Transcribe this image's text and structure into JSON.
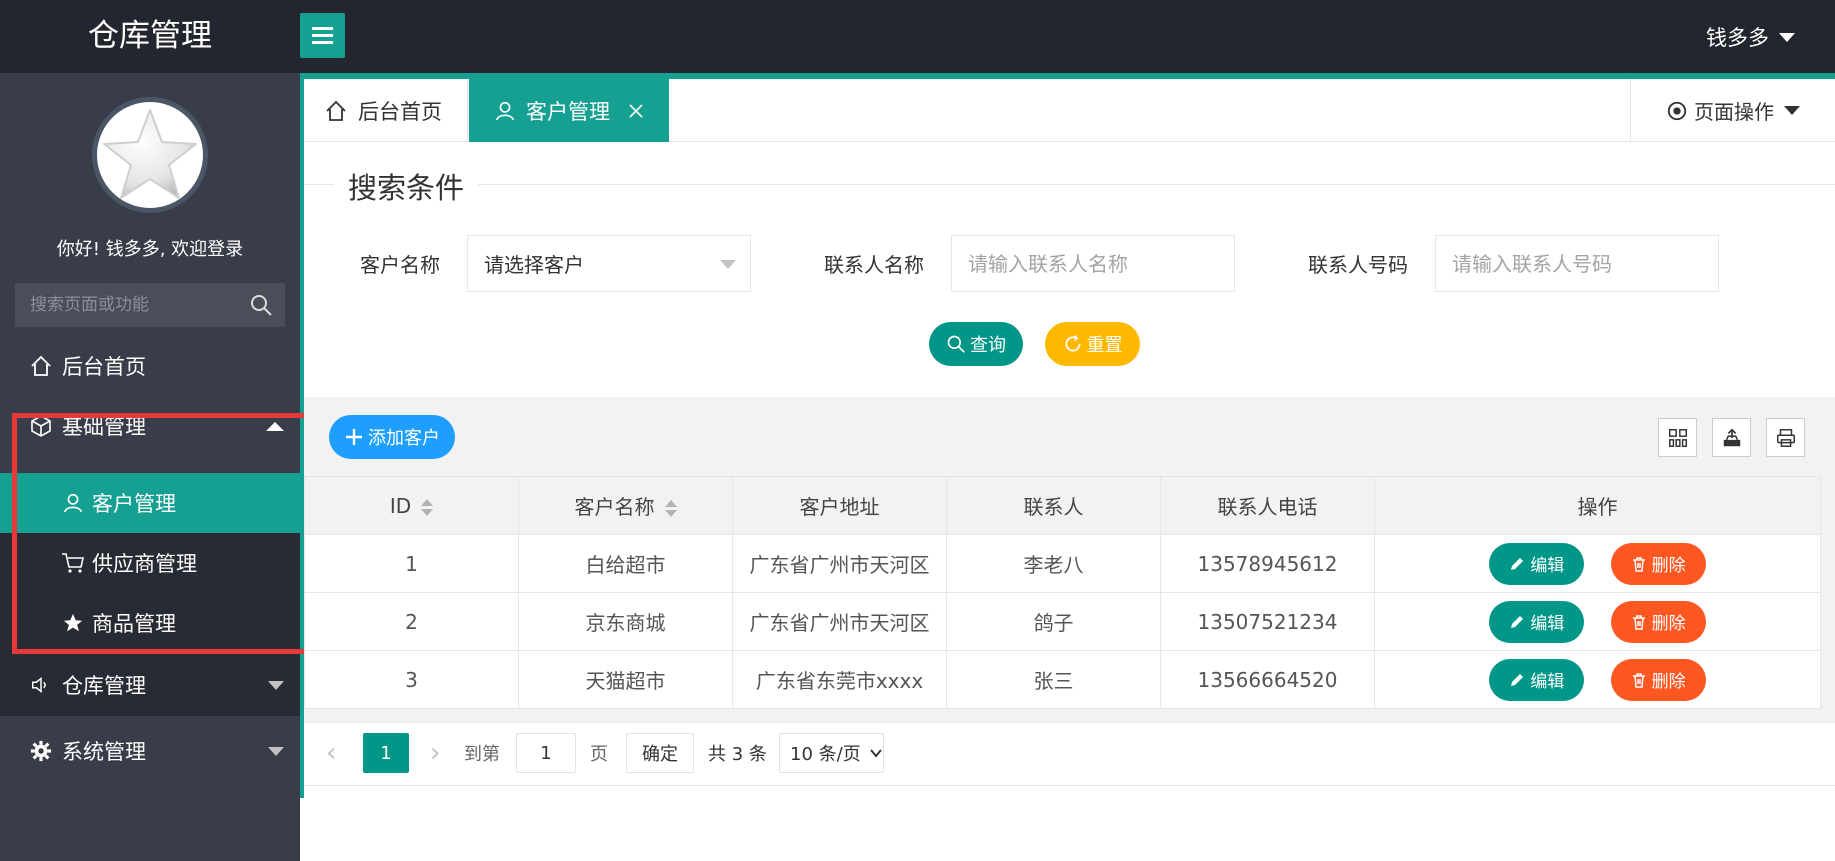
{
  "header": {
    "title": "仓库管理",
    "user": "钱多多"
  },
  "sidebar": {
    "welcome": "你好! 钱多多, 欢迎登录",
    "search_placeholder": "搜索页面或功能",
    "items": [
      {
        "label": "后台首页",
        "icon": "home-icon"
      },
      {
        "label": "基础管理",
        "icon": "cube-icon",
        "expanded": true,
        "children": [
          {
            "label": "客户管理",
            "icon": "user-icon",
            "active": true
          },
          {
            "label": "供应商管理",
            "icon": "cart-icon"
          },
          {
            "label": "商品管理",
            "icon": "star-icon"
          }
        ]
      },
      {
        "label": "仓库管理",
        "icon": "speaker-icon"
      },
      {
        "label": "系统管理",
        "icon": "gear-icon"
      }
    ]
  },
  "tabs": [
    {
      "label": "后台首页",
      "icon": "home-icon"
    },
    {
      "label": "客户管理",
      "icon": "user-icon",
      "active": true
    }
  ],
  "page_ops": "页面操作",
  "search": {
    "legend": "搜索条件",
    "customer_label": "客户名称",
    "customer_select": "请选择客户",
    "contact_label": "联系人名称",
    "contact_placeholder": "请输入联系人名称",
    "phone_label": "联系人号码",
    "phone_placeholder": "请输入联系人号码",
    "query_button": "查询",
    "reset_button": "重置"
  },
  "toolbar": {
    "add_button": "添加客户"
  },
  "table": {
    "headers": [
      "ID",
      "客户名称",
      "客户地址",
      "联系人",
      "联系人电话",
      "操作"
    ],
    "rows": [
      [
        "1",
        "白给超市",
        "广东省广州市天河区",
        "李老八",
        "13578945612"
      ],
      [
        "2",
        "京东商城",
        "广东省广州市天河区",
        "鸽子",
        "13507521234"
      ],
      [
        "3",
        "天猫超市",
        "广东省东莞市xxxx",
        "张三",
        "13566664520"
      ]
    ],
    "edit_label": "编辑",
    "delete_label": "删除"
  },
  "pager": {
    "current": "1",
    "goto_label": "到第",
    "goto_value": "1",
    "page_label": "页",
    "confirm": "确定",
    "total": "共 3 条",
    "page_size": "10 条/页"
  },
  "colors": {
    "teal": "#16a092",
    "blue": "#1e9fff",
    "orange": "#ffb800",
    "red": "#ff5722",
    "dark": "#23262e"
  }
}
